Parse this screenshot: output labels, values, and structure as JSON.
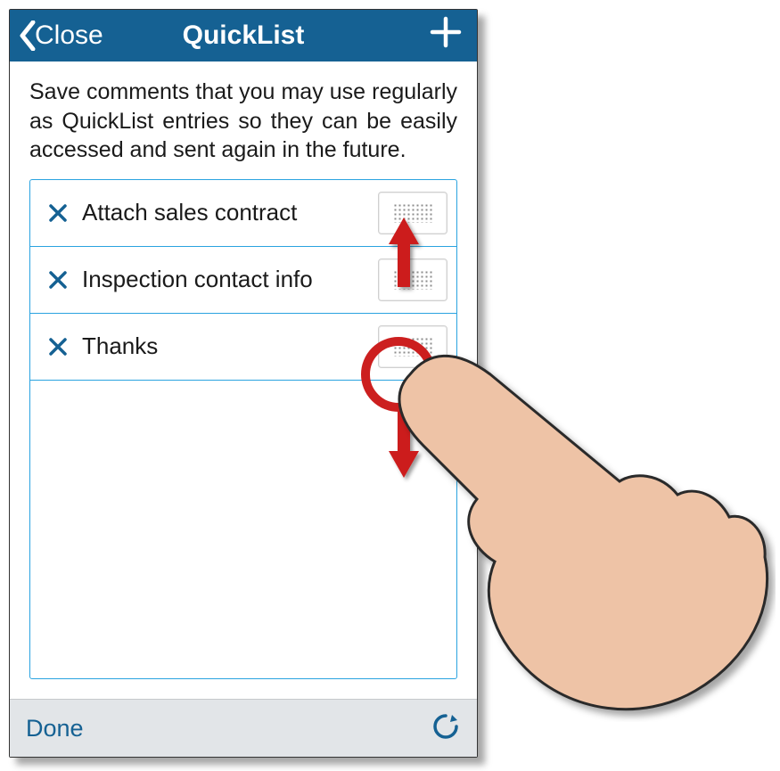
{
  "header": {
    "close_label": "Close",
    "title": "QuickList"
  },
  "intro_text": "Save comments that you may use regularly as QuickList entries so they can be easily accessed and sent again in the future.",
  "items": [
    {
      "label": "Attach sales contract"
    },
    {
      "label": "Inspection contact info"
    },
    {
      "label": "Thanks"
    }
  ],
  "footer": {
    "done_label": "Done"
  }
}
